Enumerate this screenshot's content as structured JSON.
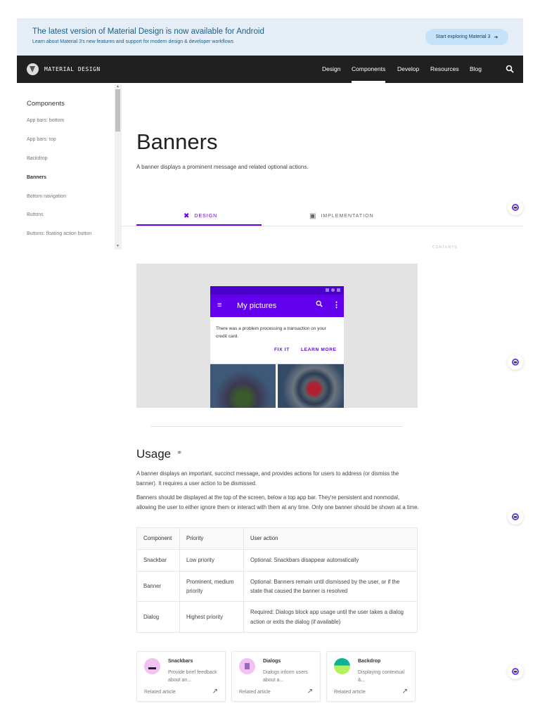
{
  "promo": {
    "title": "The latest version of Material Design is now available for Android",
    "subtitle": "Learn about Material 3's new features and support for modern design & developer workflows",
    "button": "Start exploring Material 3",
    "button_arrow": "➔"
  },
  "nav": {
    "brand": "MATERIAL DESIGN",
    "links": [
      "Design",
      "Components",
      "Develop",
      "Resources",
      "Blog"
    ],
    "active": "Components",
    "search_icon": "🔍"
  },
  "sidebar": {
    "heading": "Components",
    "items": [
      "App bars: bottom",
      "App bars: top",
      "Backdrop",
      "Banners",
      "Bottom navigation",
      "Buttons",
      "Buttons: floating action button"
    ],
    "active": "Banners"
  },
  "page": {
    "title": "Banners",
    "subtitle": "A banner displays a prominent message and related optional actions.",
    "tabs": [
      {
        "label": "DESIGN",
        "icon": "✖"
      },
      {
        "label": "IMPLEMENTATION",
        "icon": "▣"
      }
    ],
    "contents_label": "CONTENTS"
  },
  "hero": {
    "app_title": "My pictures",
    "message": "There was a problem processing a transaction on your credit card.",
    "actions": [
      "FIX IT",
      "LEARN MORE"
    ]
  },
  "usage": {
    "heading": "Usage",
    "link_icon": "⚭",
    "paragraphs": [
      "A banner displays an important, succinct message, and provides actions for users to address (or dismiss the banner). It requires a user action to be dismissed.",
      "Banners should be displayed at the top of the screen, below a top app bar. They're persistent and nonmodal, allowing the user to either ignore them or interact with them at any time. Only one banner should be shown at a time."
    ],
    "table": {
      "headers": [
        "Component",
        "Priority",
        "User action"
      ],
      "rows": [
        [
          "Snackbar",
          "Low priority",
          "Optional: Snackbars disappear automatically"
        ],
        [
          "Banner",
          "Prominent, medium priority",
          "Optional: Banners remain until dismissed by the user, or if the state that caused the banner is resolved"
        ],
        [
          "Dialog",
          "Highest priority",
          "Required: Dialogs block app usage until the user takes a dialog action or exits the dialog (if available)"
        ]
      ]
    }
  },
  "related": [
    {
      "title": "Snackbars",
      "desc": "Provide brief feedback about an...",
      "label": "Related article",
      "arrow": "↗"
    },
    {
      "title": "Dialogs",
      "desc": "Dialogs inform users about a...",
      "label": "Related article",
      "arrow": "↗"
    },
    {
      "title": "Backdrop",
      "desc": "Displaying contextual &...",
      "label": "Related article",
      "arrow": "↗"
    }
  ],
  "colors": {
    "accent": "#6200ee",
    "nav_bg": "#202020",
    "promo_bg": "#e5eef6"
  }
}
